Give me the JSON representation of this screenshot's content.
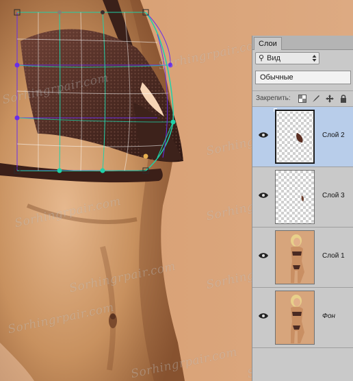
{
  "panel": {
    "tab_label": "Слои",
    "filter_label": "Вид",
    "blend_mode": "Обычные",
    "lock_label": "Закрепить:"
  },
  "layers": [
    {
      "name": "Слой 2",
      "selected": true,
      "visible": true,
      "thumb": "transparent-with-small-fragment"
    },
    {
      "name": "Слой 3",
      "selected": false,
      "visible": true,
      "thumb": "transparent-with-small-fragment"
    },
    {
      "name": "Слой 1",
      "selected": false,
      "visible": true,
      "thumb": "photo"
    },
    {
      "name": "Фон",
      "selected": false,
      "visible": true,
      "thumb": "photo"
    }
  ],
  "watermark_text": "Sorhingrpair.com",
  "icons": {
    "filter": "search-icon",
    "lock_transparent": "lock-transparent-pixels-icon",
    "lock_image": "lock-image-pixels-icon",
    "lock_position": "lock-position-icon",
    "lock_all": "lock-all-icon",
    "visibility": "eye-icon"
  },
  "colors": {
    "background_skin": "#d9a37a",
    "selected_layer": "#b8cdea",
    "grid_green": "#1fd1a8",
    "grid_purple": "#6a2ee8",
    "panel_bg": "#c9c9c9"
  }
}
